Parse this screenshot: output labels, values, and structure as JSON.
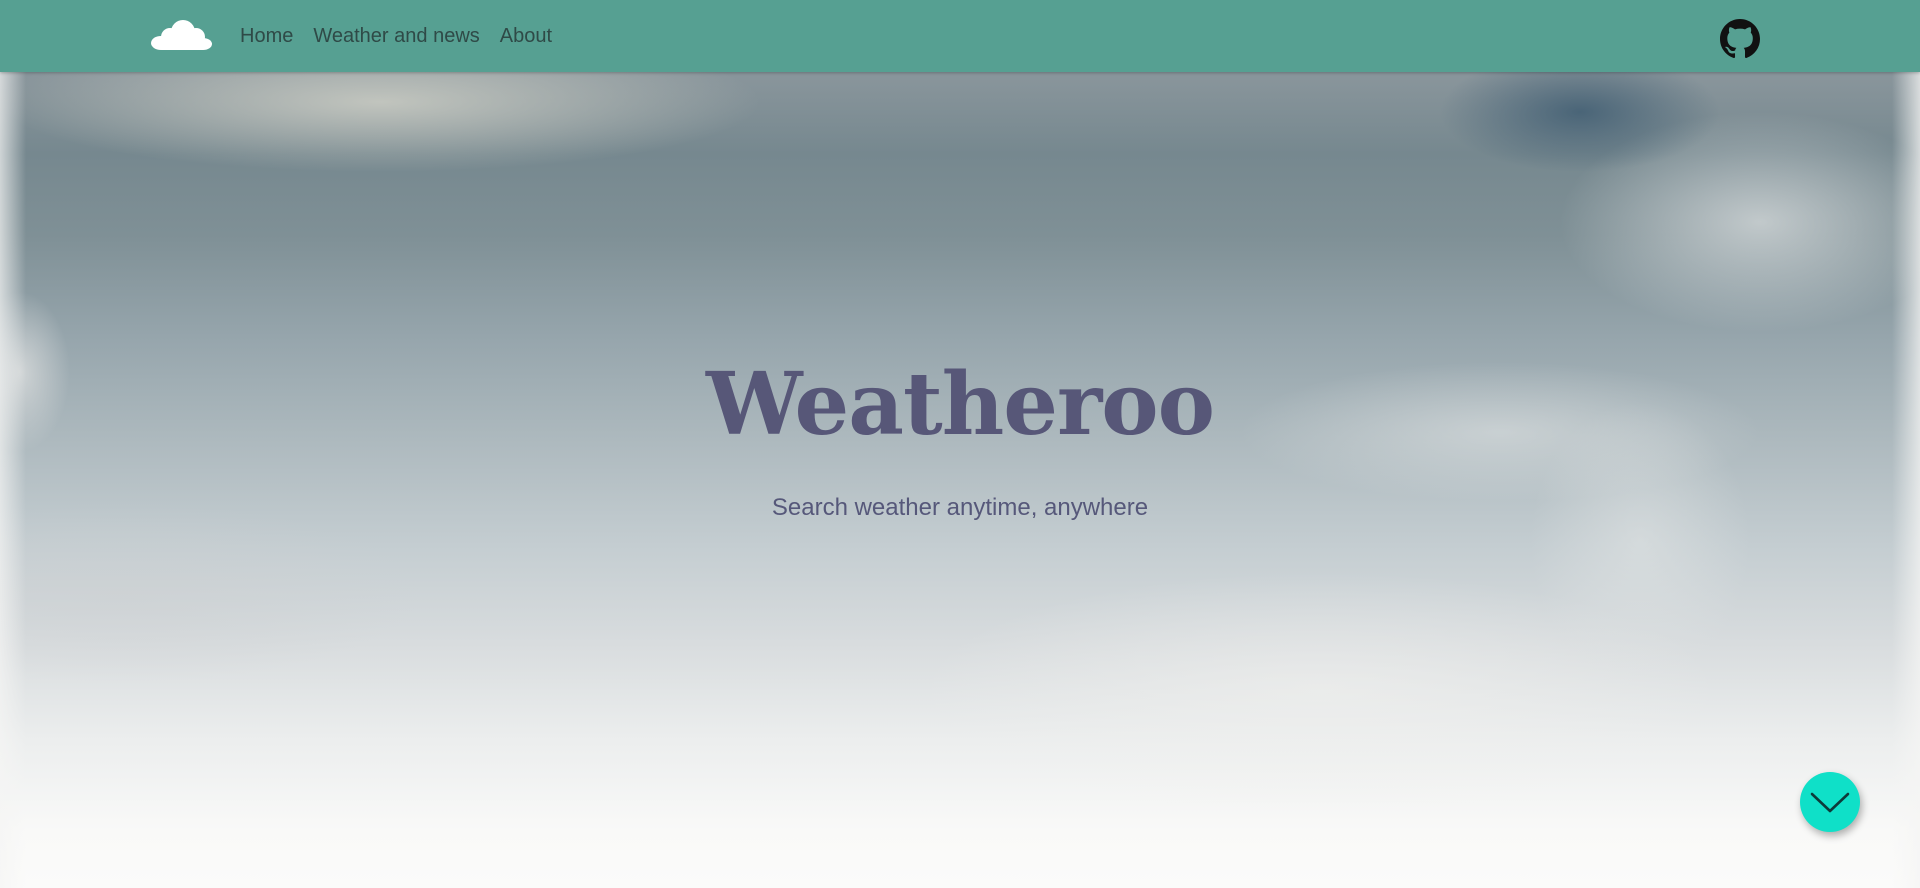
{
  "nav": {
    "logo_icon": "cloud-icon",
    "links": [
      {
        "label": "Home"
      },
      {
        "label": "Weather and news"
      },
      {
        "label": "About"
      }
    ],
    "github_icon": "github-icon"
  },
  "hero": {
    "title": "Weatheroo",
    "subtitle": "Search weather anytime, anywhere"
  },
  "scroll_button": {
    "icon": "chevron-down-icon",
    "color": "#0fe0c8"
  },
  "colors": {
    "navbar": "#56a092",
    "title": "#575778",
    "nav_text": "#2f4a47"
  }
}
